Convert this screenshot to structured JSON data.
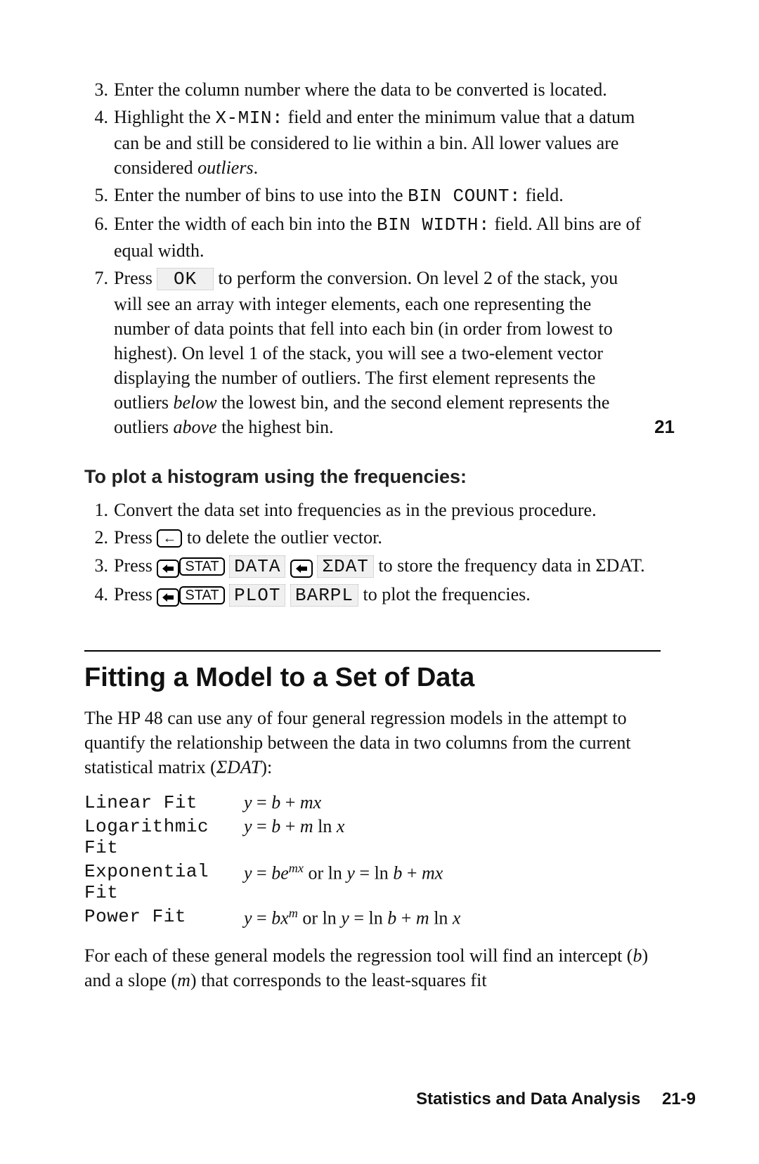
{
  "marginnum": "21",
  "list1": {
    "items": [
      {
        "n": "3.",
        "html": "Enter the column number where the data to be converted is located."
      },
      {
        "n": "4.",
        "html": "Highlight the <span class='mono'>X-MIN:</span> field and enter the minimum value that a datum can be and still be considered to lie within a bin. All lower values are considered <span class='ital'>outliers</span>."
      },
      {
        "n": "5.",
        "html": "Enter the number of bins to use into the <span class='mono'>BIN COUNT:</span> field."
      },
      {
        "n": "6.",
        "html": "Enter the width of each bin into the <span class='mono'>BIN WIDTH:</span> field. All bins are of equal width."
      },
      {
        "n": "7.",
        "html": "Press <span class='softkey'>&nbsp;OK&nbsp;</span> to perform the conversion. On level 2 of the stack, you will see an array with integer elements, each one representing the number of data points that fell into each bin (in order from lowest to highest). On level 1 of the stack, you will see a two-element vector displaying the number of outliers. The first element represents the outliers <span class='ital'>below</span> the lowest bin, and the second element represents the outliers <span class='ital'>above</span> the highest bin."
      }
    ]
  },
  "subhead1": "To plot a histogram using the frequencies:",
  "list2": {
    "items": [
      {
        "n": "1.",
        "html": "Convert the data set into frequencies as in the previous procedure."
      },
      {
        "n": "2.",
        "html": "Press <span class='keybox' data-name='backspace-key' data-interactable='false'>&#8592;</span> to delete the outlier vector."
      },
      {
        "n": "3.",
        "html": "Press <span class='shiftkey' data-name='left-shift-key' data-interactable='false'><svg width='18' height='14' viewBox='0 0 18 14'><path d='M1 7 L8 1 L8 4 L17 4 L17 10 L8 10 L8 13 Z' fill='#000'/></svg></span><span class='keybox' data-name='stat-key' data-interactable='false'>STAT</span> <span class='softkey'>DATA</span> <span class='shiftkey' data-name='left-shift-key' data-interactable='false'><svg width='18' height='14' viewBox='0 0 18 14'><path d='M1 7 L8 1 L8 4 L17 4 L17 10 L8 10 L8 13 Z' fill='#000'/></svg></span> <span class='softkey'>&Sigma;DAT</span> to store the frequency data in &Sigma;DAT."
      },
      {
        "n": "4.",
        "html": "Press <span class='shiftkey' data-name='left-shift-key' data-interactable='false'><svg width='18' height='14' viewBox='0 0 18 14'><path d='M1 7 L8 1 L8 4 L17 4 L17 10 L8 10 L8 13 Z' fill='#000'/></svg></span><span class='keybox' data-name='stat-key' data-interactable='false'>STAT</span> <span class='softkey'>PLOT</span> <span class='softkey'>BARPL</span> to plot the frequencies."
      }
    ]
  },
  "sectionTitle": "Fitting a Model to a Set of Data",
  "para1": "The HP 48 can use any of four general regression models in the attempt to quantify the relationship between the data in two columns from the current statistical matrix (<span class='ital'>ΣDAT</span>):",
  "models": [
    {
      "name": "Linear Fit",
      "eq": "<span class='ital'>y</span> = <span class='ital'>b</span> + <span class='ital'>mx</span>"
    },
    {
      "name": "Logarithmic Fit",
      "eq": "<span class='ital'>y</span> = <span class='ital'>b</span> + <span class='ital'>m</span> ln <span class='ital'>x</span>"
    },
    {
      "name": "Exponential Fit",
      "eq": "<span class='ital'>y</span> = <span class='ital'>be</span><span class='sup ital'>mx</span> or ln <span class='ital'>y</span> = ln <span class='ital'>b</span> + <span class='ital'>mx</span>"
    },
    {
      "name": "Power Fit",
      "eq": "<span class='ital'>y</span> = <span class='ital'>bx</span><span class='sup ital'>m</span> or ln <span class='ital'>y</span> = ln <span class='ital'>b</span> + <span class='ital'>m</span> ln <span class='ital'>x</span>"
    }
  ],
  "para2": "For each of these general models the regression tool will find an intercept (<span class='ital'>b</span>) and a slope (<span class='ital'>m</span>) that corresponds to the least-squares fit",
  "footer": "Statistics and Data Analysis  21-9"
}
